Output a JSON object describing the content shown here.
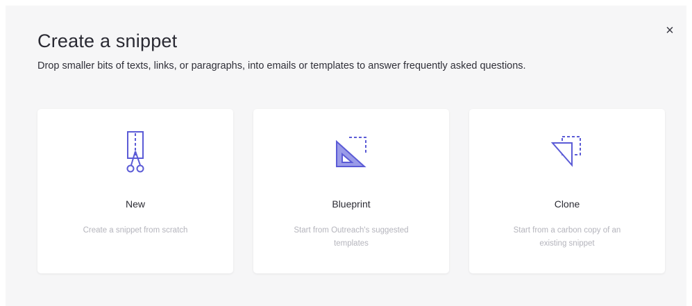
{
  "header": {
    "title": "Create a snippet",
    "subtitle": "Drop smaller bits of texts, links, or paragraphs, into emails or templates to answer frequently asked questions.",
    "close_glyph": "×"
  },
  "accent_color": "#5b5bd6",
  "cards": [
    {
      "icon": "scissors-icon",
      "title": "New",
      "description": "Create a snippet from scratch"
    },
    {
      "icon": "blueprint-icon",
      "title": "Blueprint",
      "description": "Start from Outreach's suggested templates"
    },
    {
      "icon": "clone-icon",
      "title": "Clone",
      "description": "Start from a carbon copy of an existing snippet"
    }
  ]
}
